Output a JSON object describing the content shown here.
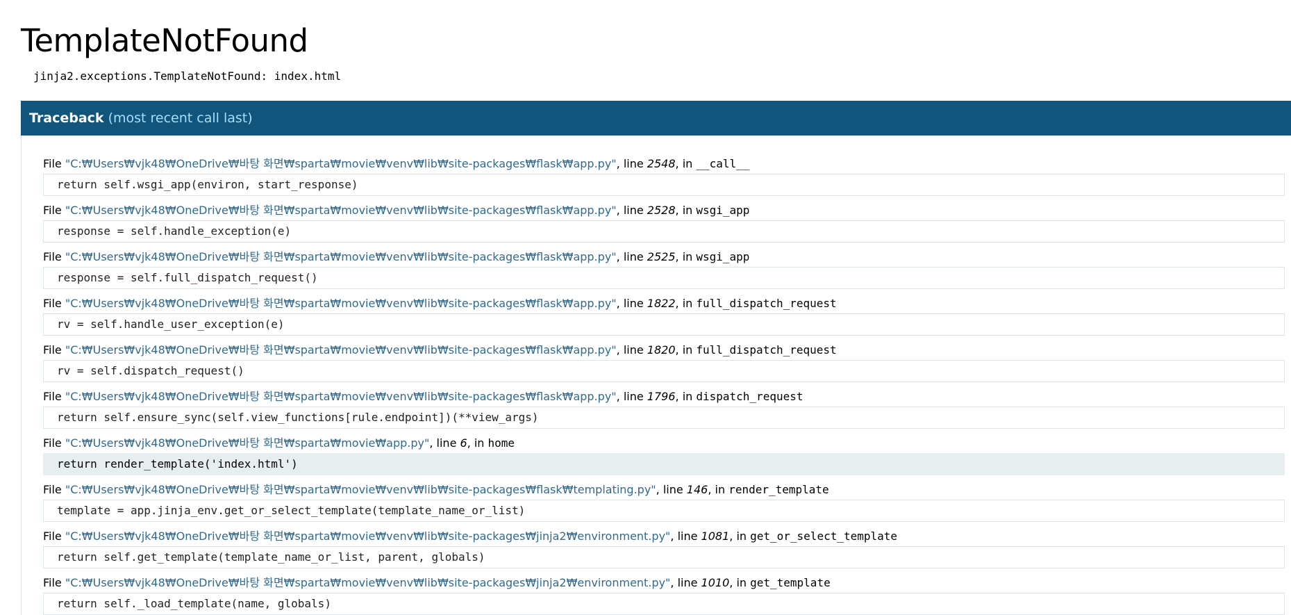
{
  "title": "TemplateNotFound",
  "error_message": "jinja2.exceptions.TemplateNotFound: index.html",
  "traceback": {
    "label": "Traceback",
    "hint": "(most recent call last)",
    "frames": [
      {
        "file_label": "File",
        "filename": "\"C:₩Users₩vjk48₩OneDrive₩바탕 화면₩sparta₩movie₩venv₩lib₩site-packages₩flask₩app.py\"",
        "line_label": ", line ",
        "lineno": "2548",
        "in_label": ", in ",
        "func": "__call__",
        "code": "return self.wsgi_app(environ, start_response)"
      },
      {
        "file_label": "File",
        "filename": "\"C:₩Users₩vjk48₩OneDrive₩바탕 화면₩sparta₩movie₩venv₩lib₩site-packages₩flask₩app.py\"",
        "line_label": ", line ",
        "lineno": "2528",
        "in_label": ", in ",
        "func": "wsgi_app",
        "code": "response = self.handle_exception(e)"
      },
      {
        "file_label": "File",
        "filename": "\"C:₩Users₩vjk48₩OneDrive₩바탕 화면₩sparta₩movie₩venv₩lib₩site-packages₩flask₩app.py\"",
        "line_label": ", line ",
        "lineno": "2525",
        "in_label": ", in ",
        "func": "wsgi_app",
        "code": "response = self.full_dispatch_request()"
      },
      {
        "file_label": "File",
        "filename": "\"C:₩Users₩vjk48₩OneDrive₩바탕 화면₩sparta₩movie₩venv₩lib₩site-packages₩flask₩app.py\"",
        "line_label": ", line ",
        "lineno": "1822",
        "in_label": ", in ",
        "func": "full_dispatch_request",
        "code": "rv = self.handle_user_exception(e)"
      },
      {
        "file_label": "File",
        "filename": "\"C:₩Users₩vjk48₩OneDrive₩바탕 화면₩sparta₩movie₩venv₩lib₩site-packages₩flask₩app.py\"",
        "line_label": ", line ",
        "lineno": "1820",
        "in_label": ", in ",
        "func": "full_dispatch_request",
        "code": "rv = self.dispatch_request()"
      },
      {
        "file_label": "File",
        "filename": "\"C:₩Users₩vjk48₩OneDrive₩바탕 화면₩sparta₩movie₩venv₩lib₩site-packages₩flask₩app.py\"",
        "line_label": ", line ",
        "lineno": "1796",
        "in_label": ", in ",
        "func": "dispatch_request",
        "code": "return self.ensure_sync(self.view_functions[rule.endpoint])(**view_args)"
      },
      {
        "file_label": "File",
        "filename": "\"C:₩Users₩vjk48₩OneDrive₩바탕 화면₩sparta₩movie₩app.py\"",
        "line_label": ", line ",
        "lineno": "6",
        "in_label": ", in ",
        "func": "home",
        "code": "return render_template('index.html')",
        "current": true
      },
      {
        "file_label": "File",
        "filename": "\"C:₩Users₩vjk48₩OneDrive₩바탕 화면₩sparta₩movie₩venv₩lib₩site-packages₩flask₩templating.py\"",
        "line_label": ", line ",
        "lineno": "146",
        "in_label": ", in ",
        "func": "render_template",
        "code": "template = app.jinja_env.get_or_select_template(template_name_or_list)"
      },
      {
        "file_label": "File",
        "filename": "\"C:₩Users₩vjk48₩OneDrive₩바탕 화면₩sparta₩movie₩venv₩lib₩site-packages₩jinja2₩environment.py\"",
        "line_label": ", line ",
        "lineno": "1081",
        "in_label": ", in ",
        "func": "get_or_select_template",
        "code": "return self.get_template(template_name_or_list, parent, globals)"
      },
      {
        "file_label": "File",
        "filename": "\"C:₩Users₩vjk48₩OneDrive₩바탕 화면₩sparta₩movie₩venv₩lib₩site-packages₩jinja2₩environment.py\"",
        "line_label": ", line ",
        "lineno": "1010",
        "in_label": ", in ",
        "func": "get_template",
        "code": "return self._load_template(name, globals)"
      }
    ]
  },
  "colors": {
    "header_bg": "#11557c",
    "header_hint": "#a7dfff",
    "filename": "#336a8c",
    "current_line_bg": "#e7eeef"
  }
}
